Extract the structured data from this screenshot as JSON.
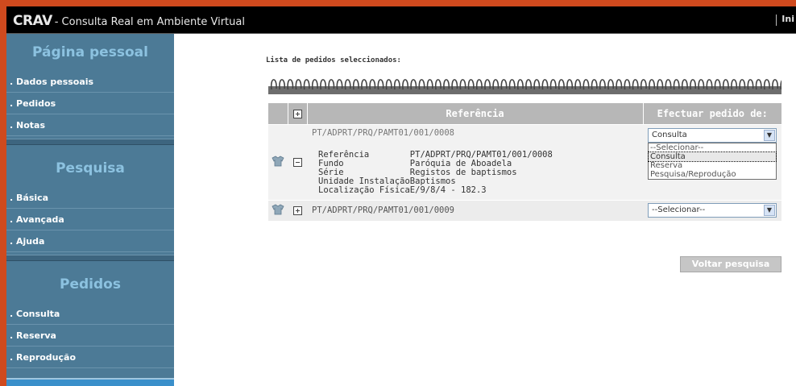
{
  "header": {
    "brand_main": "CRAV",
    "brand_sub": "- Consulta Real em Ambiente Virtual",
    "right_link": "Ini"
  },
  "sidebar": {
    "sections": [
      {
        "title": "Página pessoal",
        "items": [
          ". Dados pessoais",
          ". Pedidos",
          ". Notas"
        ]
      },
      {
        "title": "Pesquisa",
        "items": [
          ". Básica",
          ". Avançada",
          ". Ajuda"
        ]
      },
      {
        "title": "Pedidos",
        "items": [
          ". Consulta",
          ". Reserva",
          ". Reprodução"
        ]
      }
    ]
  },
  "main": {
    "list_title": "Lista de pedidos seleccionados:",
    "table": {
      "headers": {
        "reference": "Referência",
        "order": "Efectuar pedido de:"
      },
      "rows": [
        {
          "reference": "PT/ADPRT/PRQ/PAMT01/001/0008",
          "expanded": true,
          "selected_value": "Consulta",
          "details": [
            {
              "label": "Referência",
              "value": "PT/ADPRT/PRQ/PAMT01/001/0008"
            },
            {
              "label": "Fundo",
              "value": "Paróquia de Aboadela"
            },
            {
              "label": "Série",
              "value": "Registos de baptismos"
            },
            {
              "label": "Unidade Instalação",
              "value": "Baptismos"
            },
            {
              "label": "Localização Física",
              "value": "E/9/8/4 - 182.3"
            }
          ],
          "dropdown_options": [
            "--Selecionar--",
            "Consulta",
            "Reserva",
            "Pesquisa/Reprodução"
          ]
        },
        {
          "reference": "PT/ADPRT/PRQ/PAMT01/001/0009",
          "expanded": false,
          "selected_value": "--Selecionar--"
        }
      ]
    },
    "back_button": "Voltar pesquisa"
  },
  "colors": {
    "frame": "#cf4a1e",
    "sidebar": "#4c7a96",
    "sidebar_title": "#8cc2e0",
    "table_header": "#b7b7b7",
    "button": "#c6c6c6"
  }
}
